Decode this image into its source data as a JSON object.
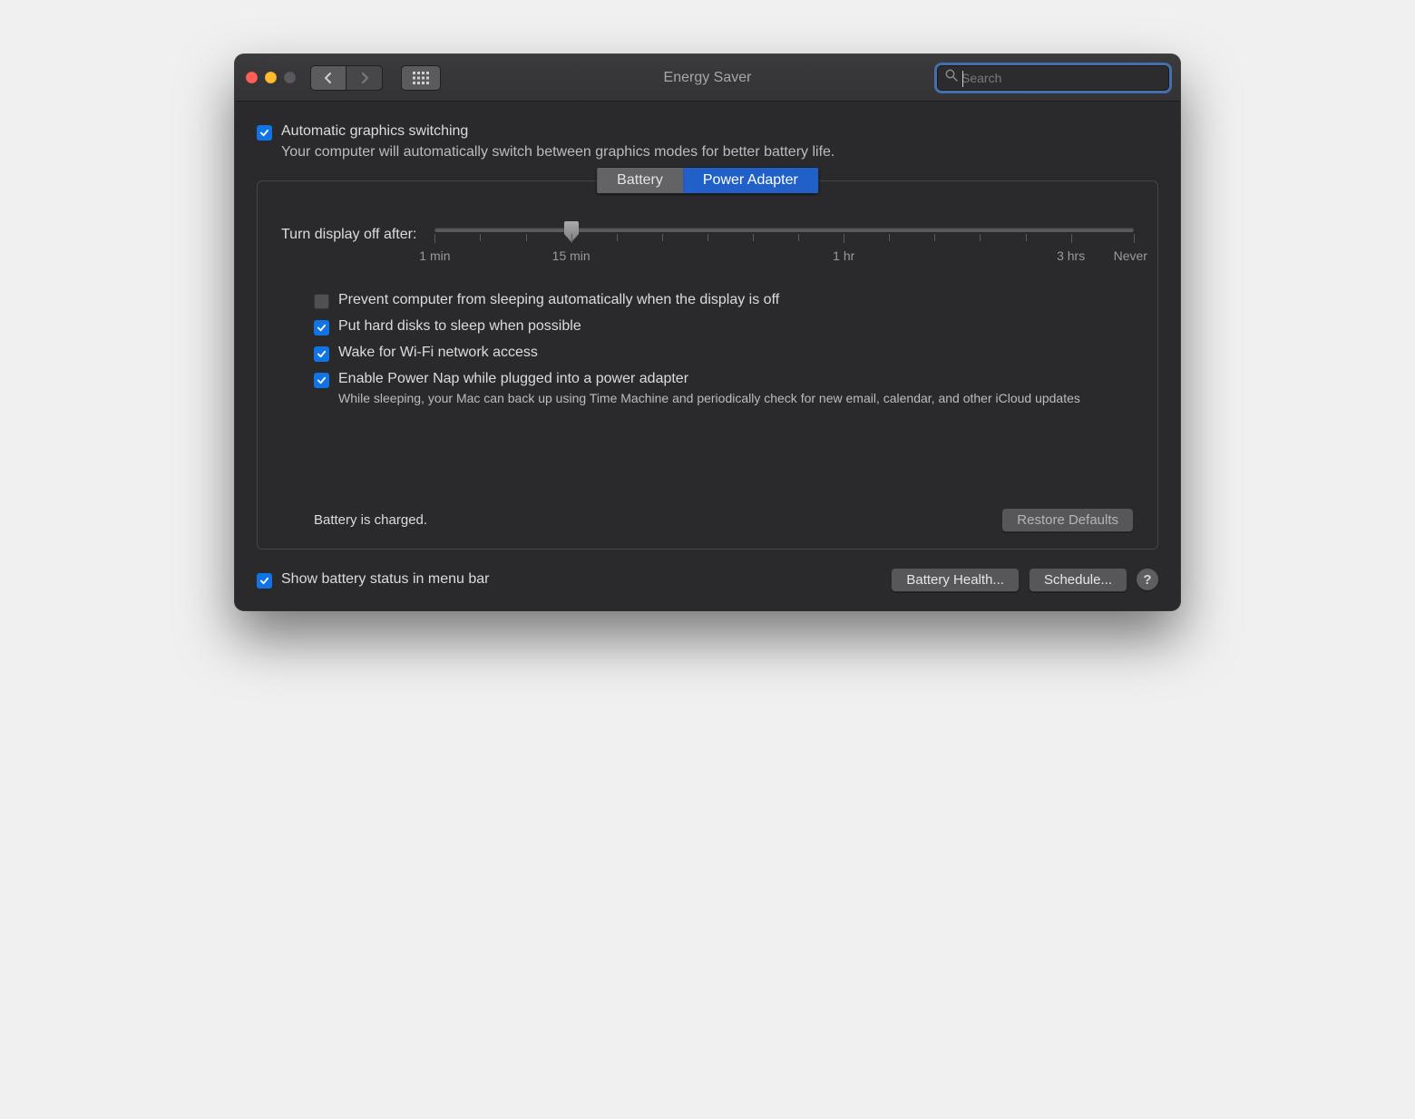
{
  "window": {
    "title": "Energy Saver"
  },
  "search": {
    "placeholder": "Search"
  },
  "auto_graphics": {
    "label": "Automatic graphics switching",
    "description": "Your computer will automatically switch between graphics modes for better battery life.",
    "checked": true
  },
  "tabs": {
    "battery": "Battery",
    "power_adapter": "Power Adapter",
    "active": "power_adapter"
  },
  "slider": {
    "label": "Turn display off after:",
    "marks": {
      "min": "1 min",
      "fifteen": "15 min",
      "hour": "1 hr",
      "three": "3 hrs",
      "never": "Never"
    }
  },
  "options": {
    "prevent_sleep": {
      "label": "Prevent computer from sleeping automatically when the display is off",
      "checked": false
    },
    "hard_disks": {
      "label": "Put hard disks to sleep when possible",
      "checked": true
    },
    "wake_wifi": {
      "label": "Wake for Wi-Fi network access",
      "checked": true
    },
    "power_nap": {
      "label": "Enable Power Nap while plugged into a power adapter",
      "description": "While sleeping, your Mac can back up using Time Machine and periodically check for new email, calendar, and other iCloud updates",
      "checked": true
    }
  },
  "status": "Battery is charged.",
  "buttons": {
    "restore_defaults": "Restore Defaults",
    "battery_health": "Battery Health...",
    "schedule": "Schedule..."
  },
  "footer": {
    "show_battery": {
      "label": "Show battery status in menu bar",
      "checked": true
    }
  }
}
